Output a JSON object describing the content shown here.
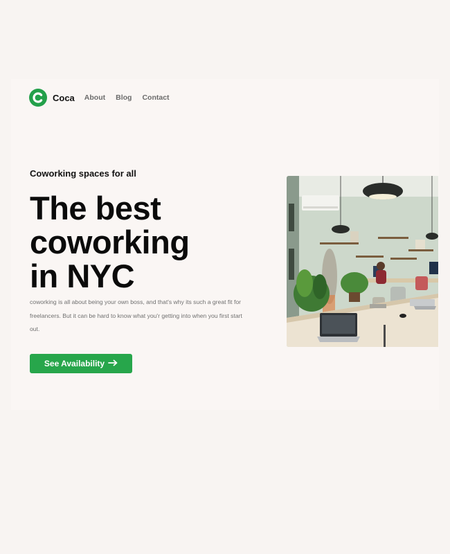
{
  "nav": {
    "logo_letter": "C",
    "brand": "Coca",
    "links": [
      {
        "label": "About"
      },
      {
        "label": "Blog"
      },
      {
        "label": "Contact"
      }
    ]
  },
  "hero": {
    "eyebrow": "Coworking spaces for all",
    "headline_lines": [
      "The best",
      "coworking",
      "in NYC"
    ],
    "description": "coworking is all about being your own boss, and that's why its such a great fit for freelancers. But it can be hard to know what you'r getting into when you first start out.",
    "cta_label": "See Availability",
    "cta_arrow": "→",
    "image_icon": "coworking-office-photo"
  },
  "colors": {
    "accent": "#27a64b",
    "background": "#f8f4f2",
    "text": "#0b0b0b",
    "muted": "#707070"
  }
}
